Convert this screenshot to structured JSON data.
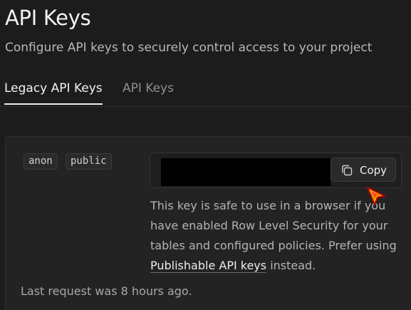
{
  "header": {
    "title": "API Keys",
    "subtitle": "Configure API keys to securely control access to your project"
  },
  "tabs": [
    {
      "label": "Legacy API Keys",
      "active": true
    },
    {
      "label": "API Keys",
      "active": false
    }
  ],
  "key_card": {
    "badges": [
      "anon",
      "public"
    ],
    "key_value": "",
    "copy_label": "Copy",
    "description_before": "This key is safe to use in a browser if you have enabled Row Level Security for your tables and configured policies. Prefer using ",
    "description_link": "Publishable API keys",
    "description_after": " instead.",
    "last_request": "Last request was 8 hours ago."
  },
  "icons": {
    "copy": "copy-icon",
    "cursor": "mouse-cursor-icon"
  },
  "colors": {
    "background": "#1c1c1c",
    "card": "#232323",
    "active_tab_underline": "#ededed",
    "key_redaction": "#000000"
  }
}
